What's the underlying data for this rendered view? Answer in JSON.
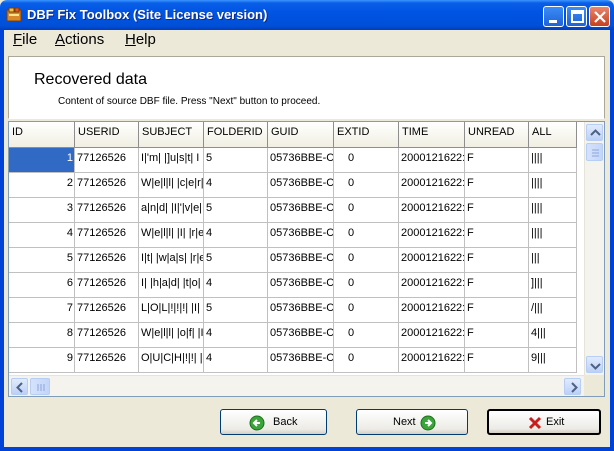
{
  "window": {
    "title": "DBF Fix Toolbox (Site License version)"
  },
  "menu": {
    "items": [
      {
        "label_u": "F",
        "label_rest": "ile"
      },
      {
        "label_u": "A",
        "label_rest": "ctions"
      },
      {
        "label_u": "H",
        "label_rest": "elp"
      }
    ]
  },
  "header": {
    "title": "Recovered data",
    "subtitle": "Content of source DBF file. Press \"Next\" button to proceed."
  },
  "grid": {
    "columns": [
      "ID",
      "USERID",
      "SUBJECT",
      "FOLDERID",
      "GUID",
      "EXTID",
      "TIME",
      "UNREAD",
      "ALL"
    ],
    "rows": [
      [
        "1",
        "77126526",
        "I|'m| |]u|s|t| I",
        "5",
        "05736BBE-C",
        "0",
        "2000121622:",
        "F",
        "||||"
      ],
      [
        "2",
        "77126526",
        "W|e|l|l| |c|e|r|",
        "4",
        "05736BBE-C",
        "0",
        "2000121622:",
        "F",
        "||||"
      ],
      [
        "3",
        "77126526",
        "a|n|d| |I|'|v|e|",
        "5",
        "05736BBE-C",
        "0",
        "2000121622:",
        "F",
        "||||"
      ],
      [
        "4",
        "77126526",
        "W|e|l|l| |I| |r|e",
        "4",
        "05736BBE-C",
        "0",
        "2000121622:",
        "F",
        "||||"
      ],
      [
        "5",
        "77126526",
        "I|t| |w|a|s| |r|e",
        "5",
        "05736BBE-C",
        "0",
        "2000121622:",
        "F",
        " |||"
      ],
      [
        "6",
        "77126526",
        "I| |h|a|d| |t|o|",
        "4",
        "05736BBE-C",
        "0",
        "2000121622:",
        "F",
        "]|||"
      ],
      [
        "7",
        "77126526",
        "L|O|L|!|!|!| |I|",
        "5",
        "05736BBE-C",
        "0",
        "2000121622:",
        "F",
        "/|||"
      ],
      [
        "8",
        "77126526",
        "W|e|l|l| |o|f| |I",
        "4",
        "05736BBE-C",
        "0",
        "2000121622:",
        "F",
        "4|||"
      ],
      [
        "9",
        "77126526",
        "O|U|C|H|!|!| |I",
        "4",
        "05736BBE-C",
        "0",
        "2000121622:",
        "F",
        "9|||"
      ]
    ]
  },
  "buttons": {
    "back": "Back",
    "next": "Next",
    "exit": "Exit"
  }
}
